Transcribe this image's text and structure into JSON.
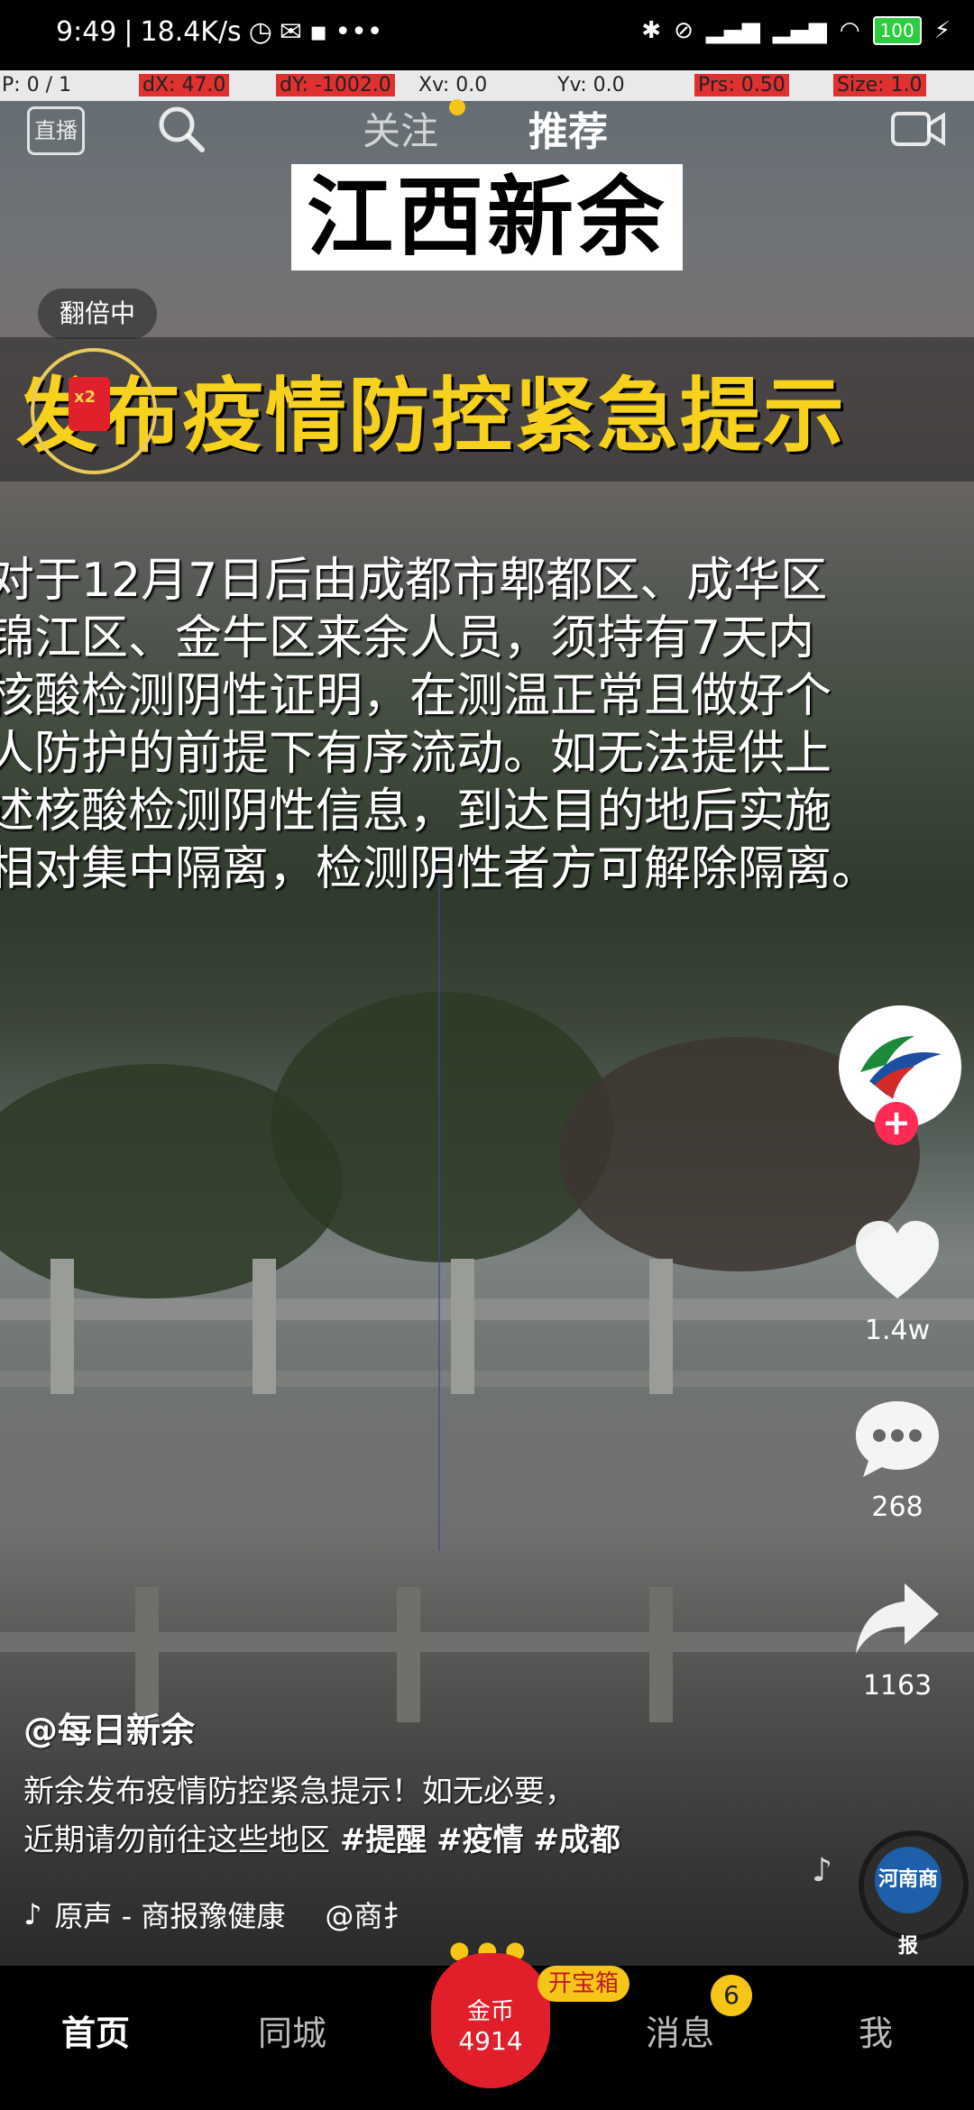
{
  "status_bar": {
    "time": "9:49",
    "net_speed": "18.4K/s",
    "battery": "100"
  },
  "debug_overlay": {
    "p": "P: 0 / 1",
    "dx": "dX: 47.0",
    "dy": "dY: -1002.0",
    "xv": "Xv: 0.0",
    "yv": "Yv: 0.0",
    "prs": "Prs: 0.50",
    "size": "Size: 1.0"
  },
  "top_nav": {
    "live_label": "直播",
    "follow_tab": "关注",
    "recommend_tab": "推荐"
  },
  "video_overlay": {
    "city_title": "江西新余",
    "double_badge": "翻倍中",
    "redpack_multiplier": "x2",
    "headline": "发布疫情防控紧急提示",
    "notice_lines": [
      "对于12月7日后由成都市郫都区、成华区",
      "锦江区、金牛区来余人员，须持有7天内",
      "核酸检测阴性证明，在测温正常且做好个",
      "人防护的前提下有序流动。如无法提供上",
      "述核酸检测阴性信息，到达目的地后实施",
      "相对集中隔离，检测阴性者方可解除隔离。"
    ]
  },
  "actions": {
    "likes": "1.4w",
    "comments": "268",
    "shares": "1163"
  },
  "caption": {
    "author": "@每日新余",
    "line1": "新余发布疫情防控紧急提示！如无必要，",
    "line2_prefix": "近期请勿前往这些地区",
    "tags": [
      "#提醒",
      "#疫情",
      "#成都"
    ],
    "music": "原声 - 商报豫健康",
    "music_author": "@商扌",
    "disc_label": "河南商报"
  },
  "bottom_nav": {
    "home": "首页",
    "local": "同城",
    "gold_label": "金币",
    "gold_count": "4914",
    "treasure": "开宝箱",
    "messages": "消息",
    "message_badge": "6",
    "me": "我"
  },
  "colors": {
    "headline_yellow": "#f7d21c",
    "follow_red": "#fe2c55",
    "gold_red": "#e01f2a",
    "badge_yellow": "#f5c518"
  }
}
